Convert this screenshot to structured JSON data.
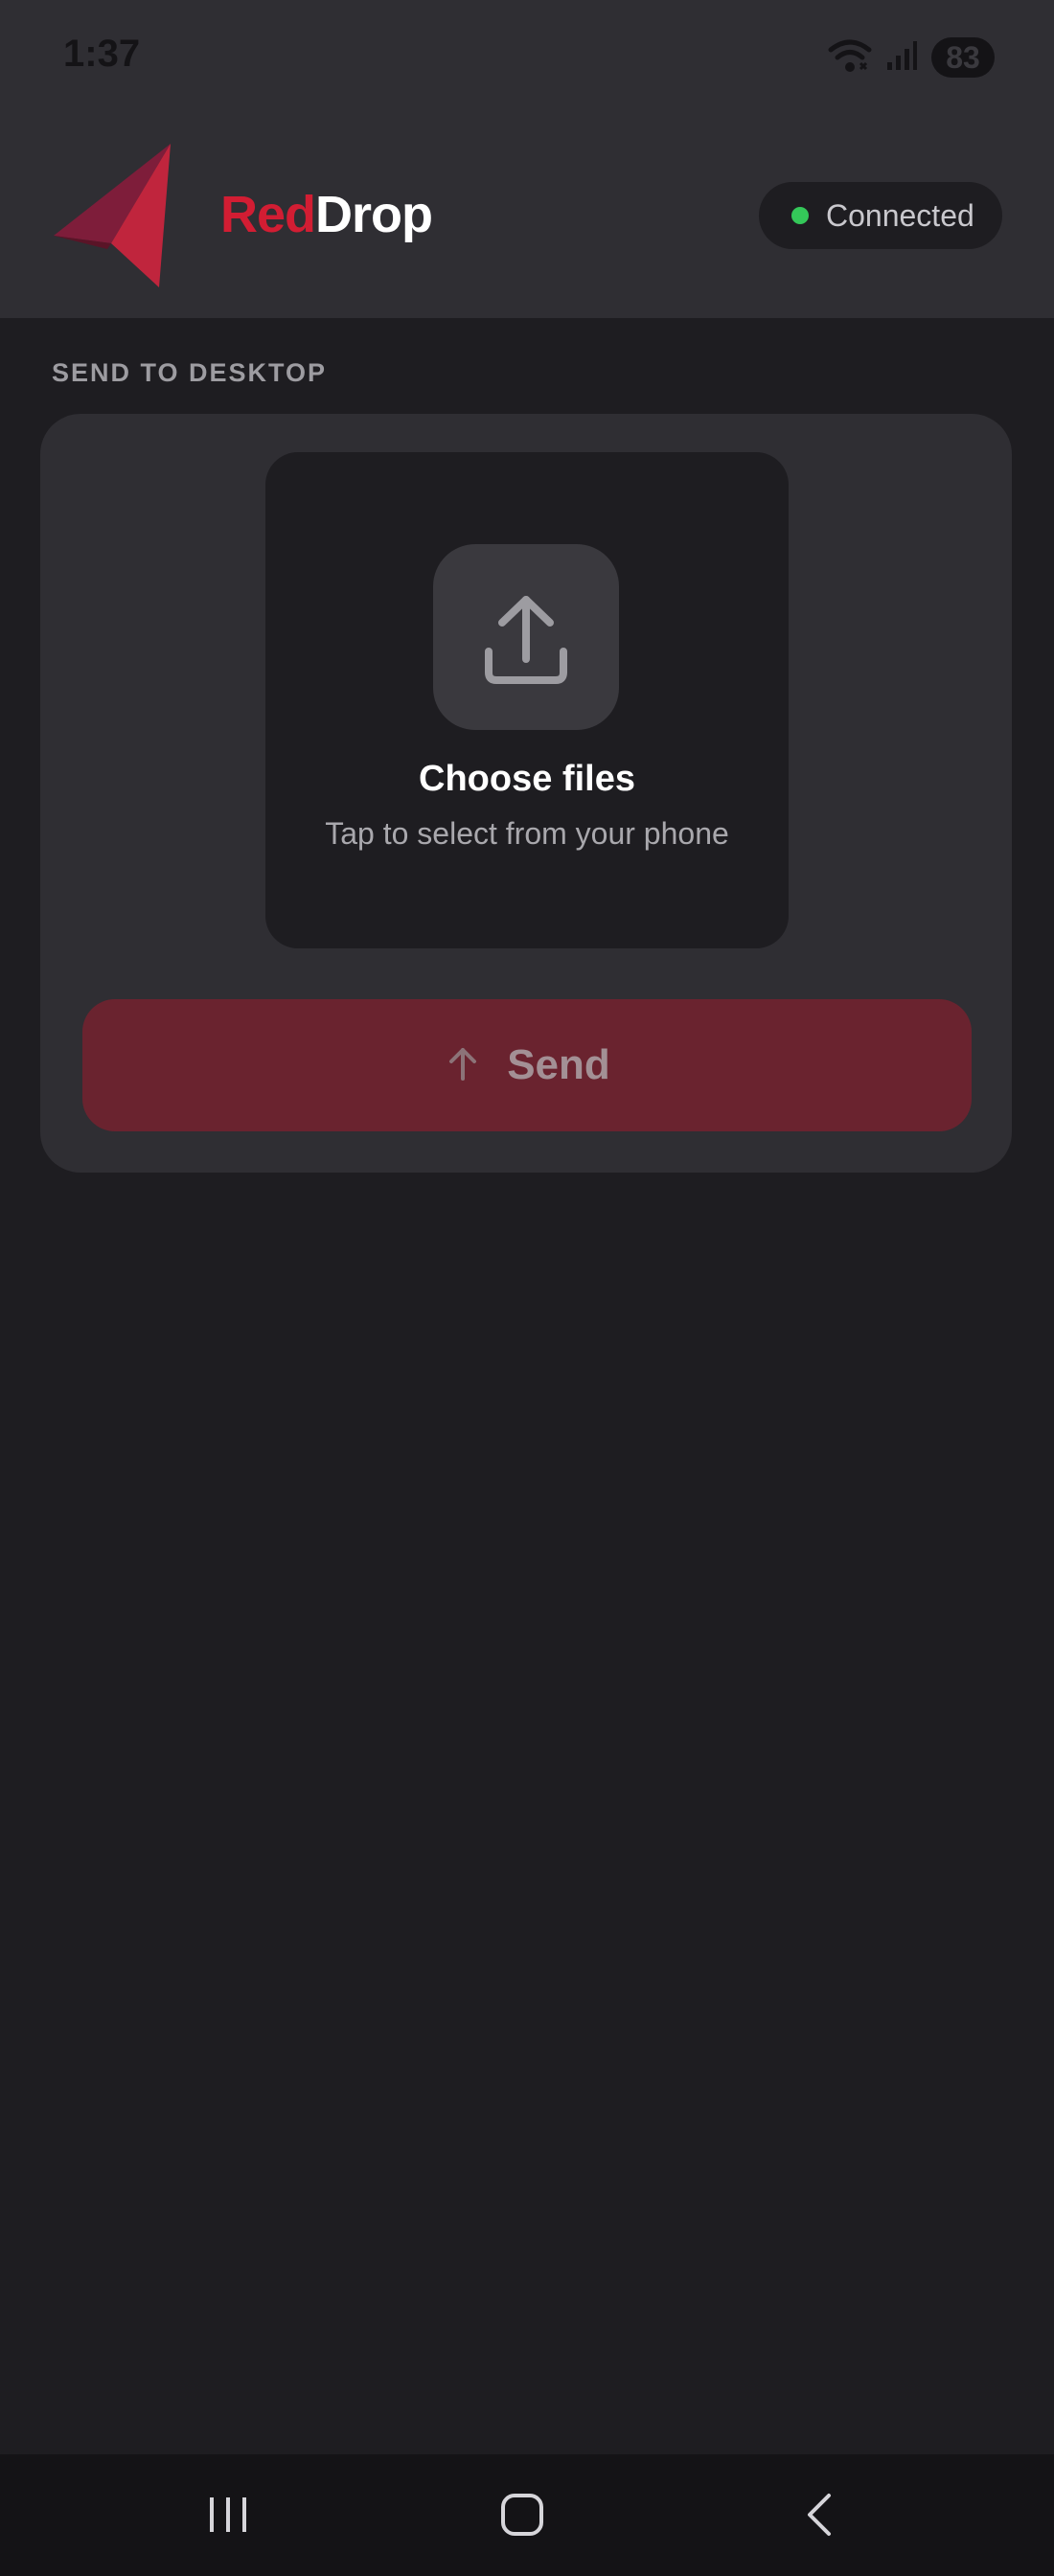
{
  "status_bar": {
    "time": "1:37",
    "battery": "83",
    "icons": [
      "wifi-icon",
      "signal-icon",
      "battery-icon"
    ]
  },
  "header": {
    "brand_part1": "Red",
    "brand_part2": "Drop",
    "connection_status": "Connected"
  },
  "send_section": {
    "label": "SEND TO DESKTOP",
    "dropzone": {
      "icon": "upload-icon",
      "title": "Choose files",
      "subtitle": "Tap to select from your phone"
    },
    "send_button": {
      "icon": "arrow-up-icon",
      "label": "Send"
    }
  },
  "nav_bar": {
    "buttons": [
      "recents-icon",
      "home-icon",
      "back-icon"
    ]
  },
  "colors": {
    "brand_red": "#d21d33",
    "connected_green": "#34c759",
    "background": "#1e1d21",
    "surface": "#2f2e33",
    "send_button_disabled": "#6a232f"
  }
}
